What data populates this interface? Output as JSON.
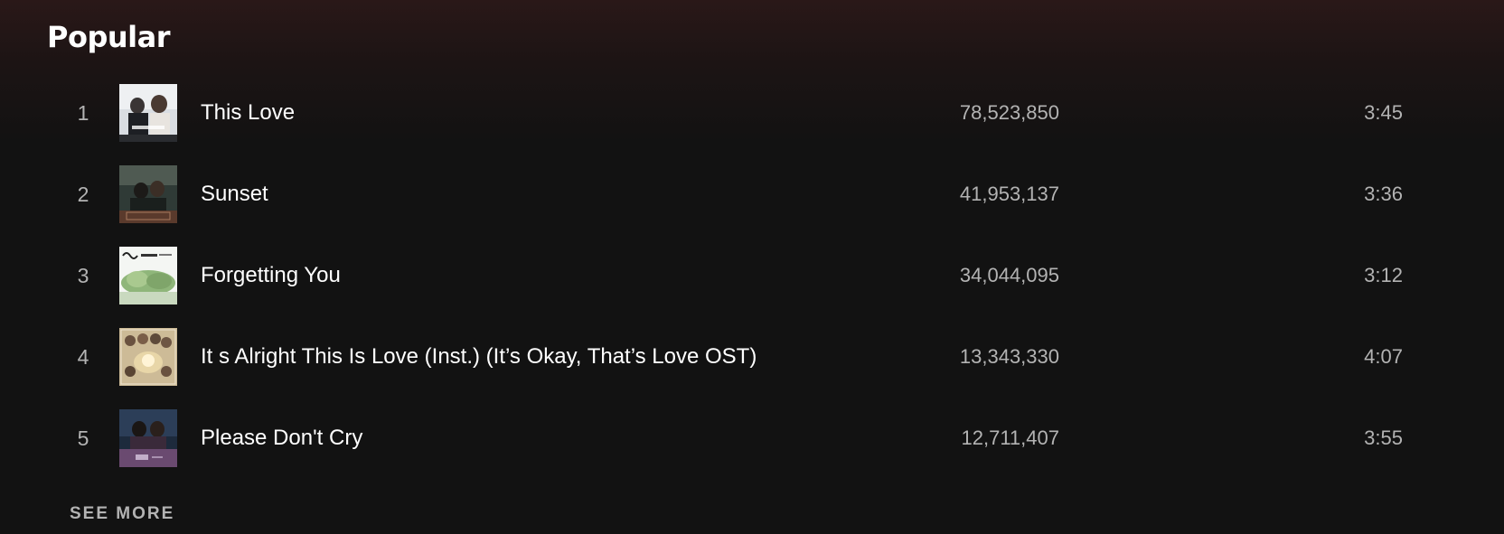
{
  "section": {
    "title": "Popular",
    "see_more_label": "SEE MORE"
  },
  "tracks": [
    {
      "index": "1",
      "title": "This Love",
      "plays": "78,523,850",
      "duration": "3:45",
      "cover_icon": "album-art-couple-bright"
    },
    {
      "index": "2",
      "title": "Sunset",
      "plays": "41,953,137",
      "duration": "3:36",
      "cover_icon": "album-art-couple-dark"
    },
    {
      "index": "3",
      "title": "Forgetting You",
      "plays": "34,044,095",
      "duration": "3:12",
      "cover_icon": "album-art-landscape-green"
    },
    {
      "index": "4",
      "title": "It s Alright This Is Love (Inst.) (It’s Okay, That’s Love OST)",
      "plays": "13,343,330",
      "duration": "4:07",
      "cover_icon": "album-art-cast-collage"
    },
    {
      "index": "5",
      "title": "Please Don't Cry",
      "plays": "12,711,407",
      "duration": "3:55",
      "cover_icon": "album-art-couple-night"
    }
  ],
  "colors": {
    "background": "#121212",
    "header_tint": "#2a1818",
    "primary_text": "#ffffff",
    "secondary_text": "#b3b3b3"
  }
}
